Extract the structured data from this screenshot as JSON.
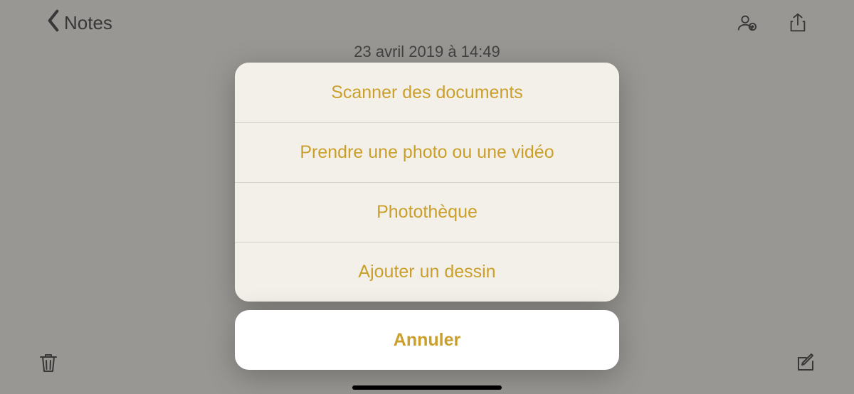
{
  "nav": {
    "back_label": "Notes"
  },
  "note": {
    "timestamp": "23 avril 2019 à 14:49"
  },
  "actionSheet": {
    "items": [
      {
        "label": "Scanner des documents"
      },
      {
        "label": "Prendre une photo ou une vidéo"
      },
      {
        "label": "Photothèque"
      },
      {
        "label": "Ajouter un dessin"
      }
    ],
    "cancel_label": "Annuler"
  },
  "colors": {
    "accent": "#cb9f2b"
  }
}
